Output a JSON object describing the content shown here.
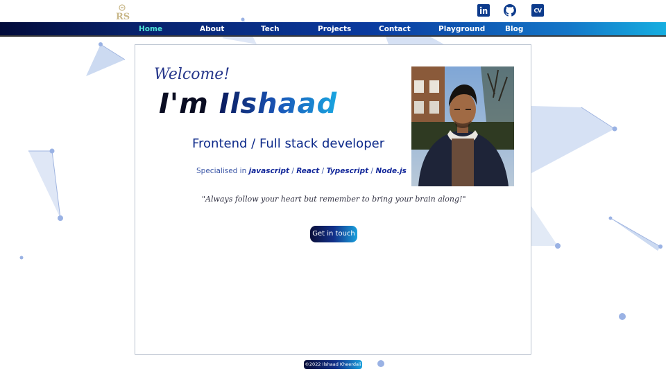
{
  "header": {
    "logo_text": "RS",
    "icons": [
      "logo-icon",
      "linkedin-icon",
      "github-icon",
      "cv-icon"
    ],
    "cv_label": "CV"
  },
  "nav": {
    "items": [
      {
        "label": "Home",
        "active": true
      },
      {
        "label": "About",
        "active": false
      },
      {
        "label": "Tech",
        "active": false
      },
      {
        "label": "Projects",
        "active": false
      },
      {
        "label": "Contact",
        "active": false
      },
      {
        "label": "Playground",
        "active": false
      },
      {
        "label": "Blog",
        "active": false
      }
    ]
  },
  "hero": {
    "welcome": "Welcome!",
    "im": "I'm",
    "name": "Ilshaad",
    "role": "Frontend / Full stack developer",
    "specialised_prefix": "Specialised in",
    "techs": [
      "javascript",
      "React",
      "Typescript",
      "Node.js"
    ],
    "separator": "/",
    "quote": "\"Always follow your heart but remember to bring your brain along!\"",
    "cta_label": "Get in touch"
  },
  "footer": {
    "copyright": "©2022 Ilshaad Kheerdali"
  },
  "colors": {
    "nav_active": "#4fe3d6",
    "accent_dark": "#0a0f3a",
    "accent_blue": "#12308a",
    "accent_cyan": "#1aa0dc"
  }
}
